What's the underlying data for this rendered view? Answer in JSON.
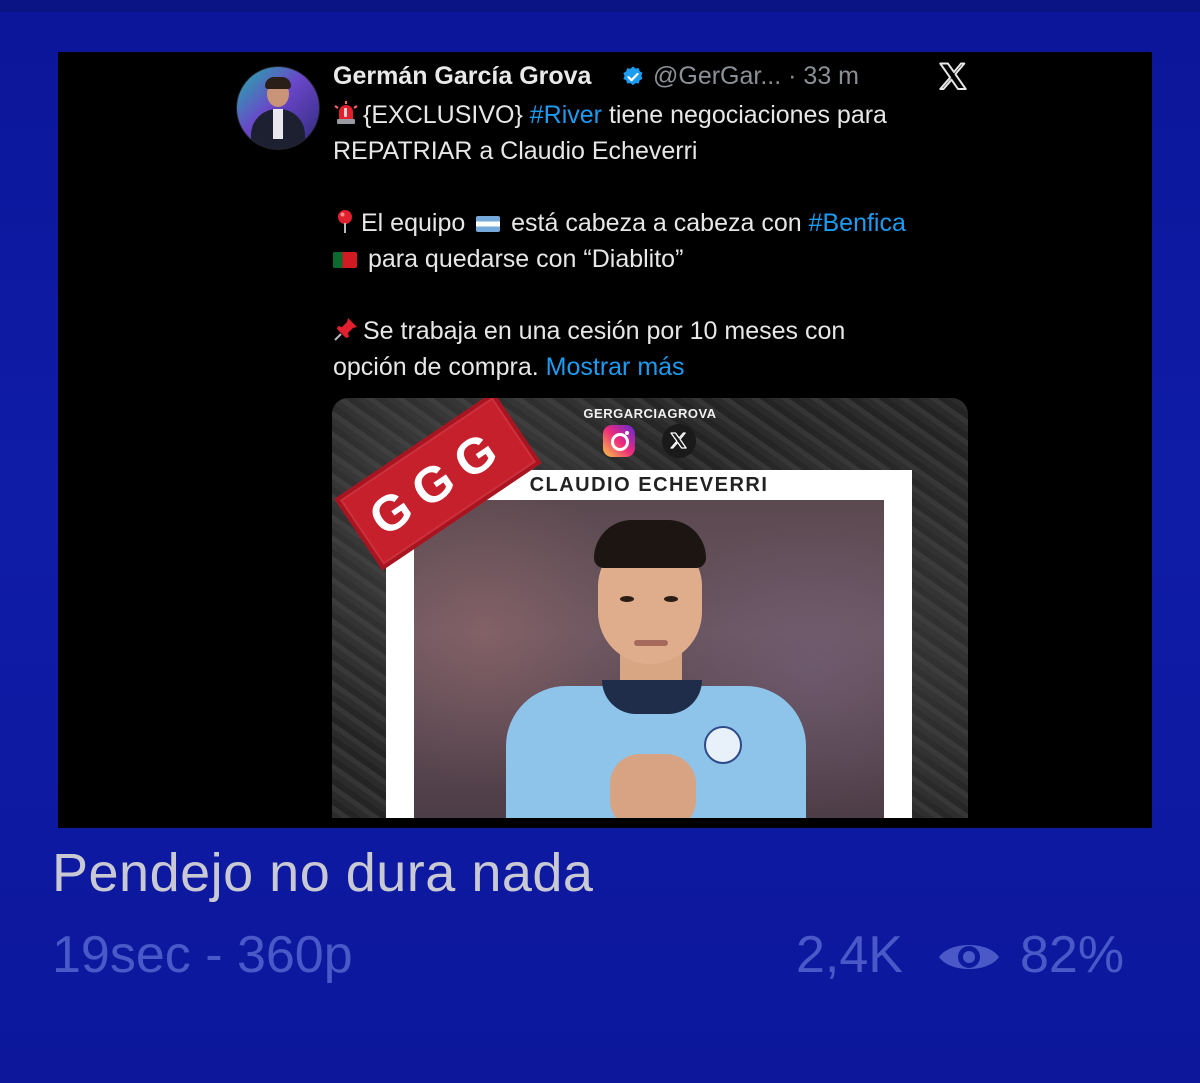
{
  "tweet": {
    "author_name": "Germán García Grova",
    "handle": "@GerGar...",
    "separator": "·",
    "time": "33 m",
    "line1_prefix": "{EXCLUSIVO}",
    "line1_tag": "#River",
    "line1_suffix": "tiene negociaciones para",
    "line2": "REPATRIAR a Claudio Echeverri",
    "line3_prefix": "El equipo",
    "line3_middle": "está cabeza a cabeza con",
    "line3_tag": "#Benfica",
    "line4": "para quedarse con “Diablito”",
    "line5": "Se trabaja en una cesión por 10 meses con",
    "line6": "opción de compra.",
    "show_more": "Mostrar más",
    "icons": {
      "siren": "siren-emoji",
      "pin": "round-pushpin-emoji",
      "pushpin": "pushpin-emoji",
      "flag_ar": "argentina-flag",
      "flag_pt": "portugal-flag"
    }
  },
  "media": {
    "brand": "GERGARCIAGROVA",
    "stamp": "GGG",
    "card_title": "CLAUDIO ECHEVERRI"
  },
  "video": {
    "title": "Pendejo no dura nada",
    "duration_quality": "19sec - 360p",
    "views": "2,4K",
    "rating": "82%"
  },
  "colors": {
    "background": "#0e1a9e",
    "link": "#1d9bf0",
    "meta_text": "#4a59c7"
  }
}
